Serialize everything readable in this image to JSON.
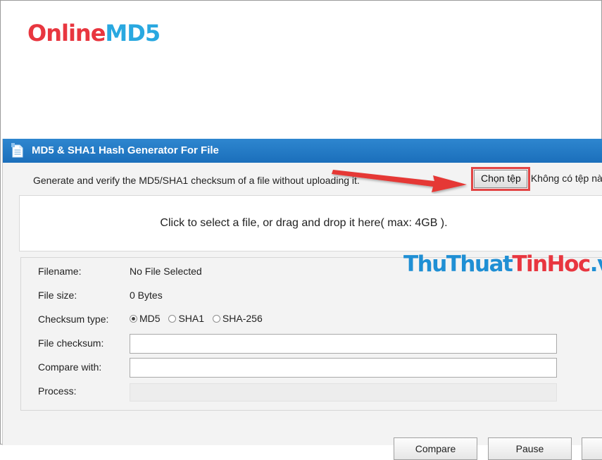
{
  "logo": {
    "part1": "Online",
    "part2": "MD5"
  },
  "panel": {
    "title": "MD5 & SHA1 Hash Generator For File",
    "intro": "Generate and verify the MD5/SHA1 checksum of a file without uploading it.",
    "file_button": "Chọn tệp",
    "no_file_text": "Không có tệp nà",
    "drop_zone": "Click to select a file, or drag and drop it here( max: 4GB )."
  },
  "details": {
    "filename_label": "Filename:",
    "filename_value": "No File Selected",
    "size_label": "File size:",
    "size_value": "0 Bytes",
    "type_label": "Checksum type:",
    "types": [
      {
        "label": "MD5",
        "checked": true
      },
      {
        "label": "SHA1",
        "checked": false
      },
      {
        "label": "SHA-256",
        "checked": false
      }
    ],
    "checksum_label": "File checksum:",
    "checksum_value": "",
    "compare_label": "Compare with:",
    "compare_value": "",
    "process_label": "Process:",
    "process_progress": 0
  },
  "buttons": {
    "compare": "Compare",
    "pause": "Pause"
  },
  "watermark": {
    "part1": "ThuThuat",
    "part2": "TinHoc",
    "part3": ".vn"
  },
  "icons": {
    "panel_icon": "document-icon",
    "arrow": "red-arrow-icon"
  },
  "colors": {
    "header_blue": "#1b6fbb",
    "logo_red": "#e8363f",
    "logo_blue": "#29a8e0",
    "highlight_red": "#e24545"
  }
}
